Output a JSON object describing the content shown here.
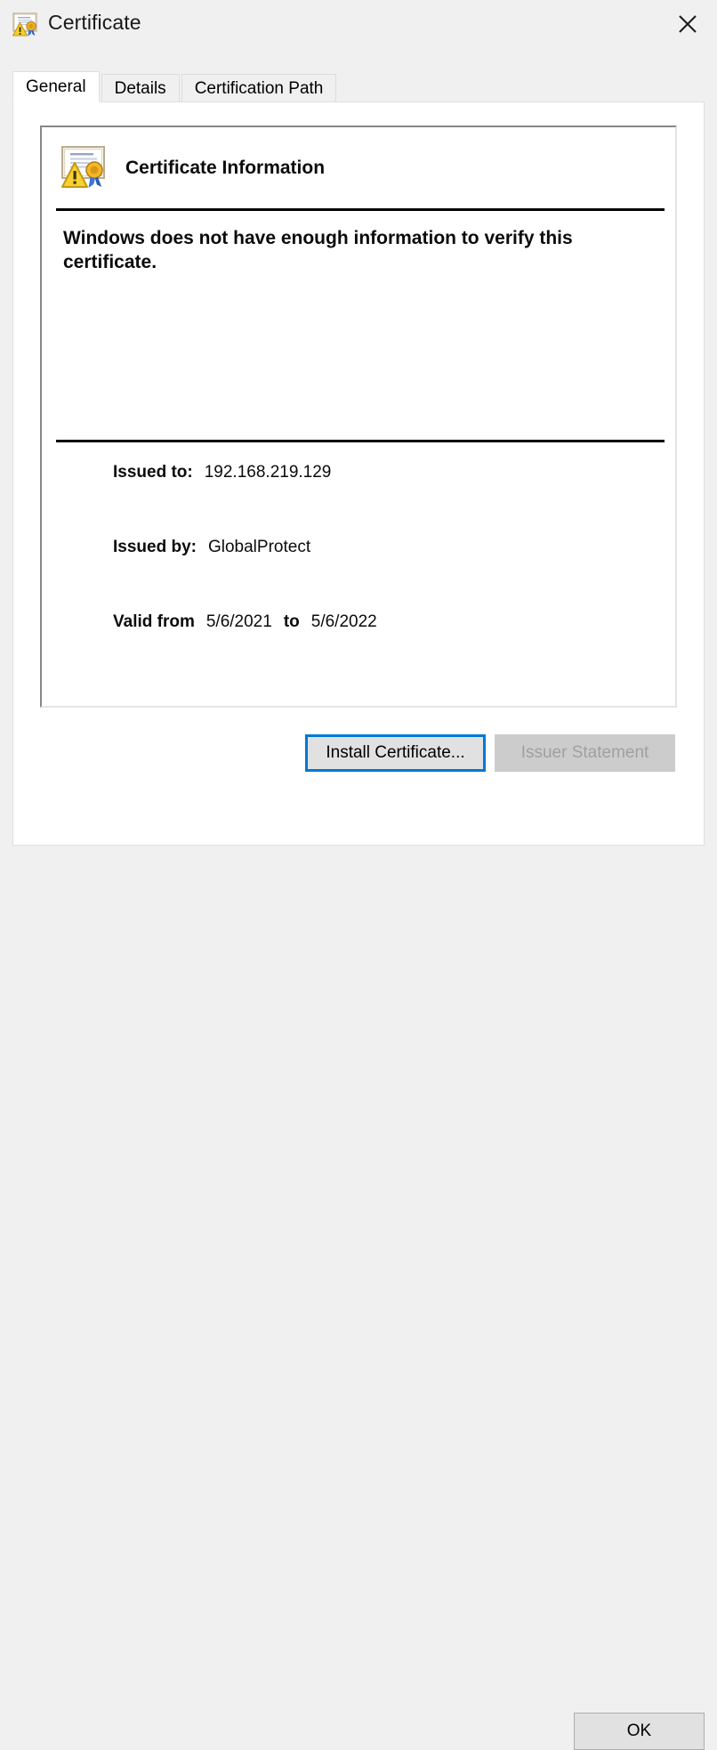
{
  "window": {
    "title": "Certificate",
    "icon": "certificate-warning-icon",
    "close_label": "✕"
  },
  "tabs": [
    {
      "label": "General",
      "active": true
    },
    {
      "label": "Details",
      "active": false
    },
    {
      "label": "Certification Path",
      "active": false
    }
  ],
  "general": {
    "header_icon": "certificate-warning-icon",
    "header_title": "Certificate Information",
    "message": "Windows does not have enough information to verify this certificate.",
    "fields": [
      {
        "label": "Issued to:",
        "value": "192.168.219.129"
      },
      {
        "label": "Issued by:",
        "value": "GlobalProtect"
      }
    ],
    "validity": {
      "label": "Valid from",
      "from": "5/6/2021",
      "separator": "to",
      "to": "5/6/2022"
    },
    "buttons": {
      "install": "Install Certificate...",
      "issuer": "Issuer Statement"
    }
  },
  "footer": {
    "ok": "OK"
  },
  "colors": {
    "accent_focus": "#0078d7",
    "dialog_background": "#f0f0f0",
    "panel_background": "#ffffff",
    "button_face": "#e1e1e1",
    "disabled_text": "#a0a0a0",
    "warning_yellow": "#ffc82e"
  }
}
